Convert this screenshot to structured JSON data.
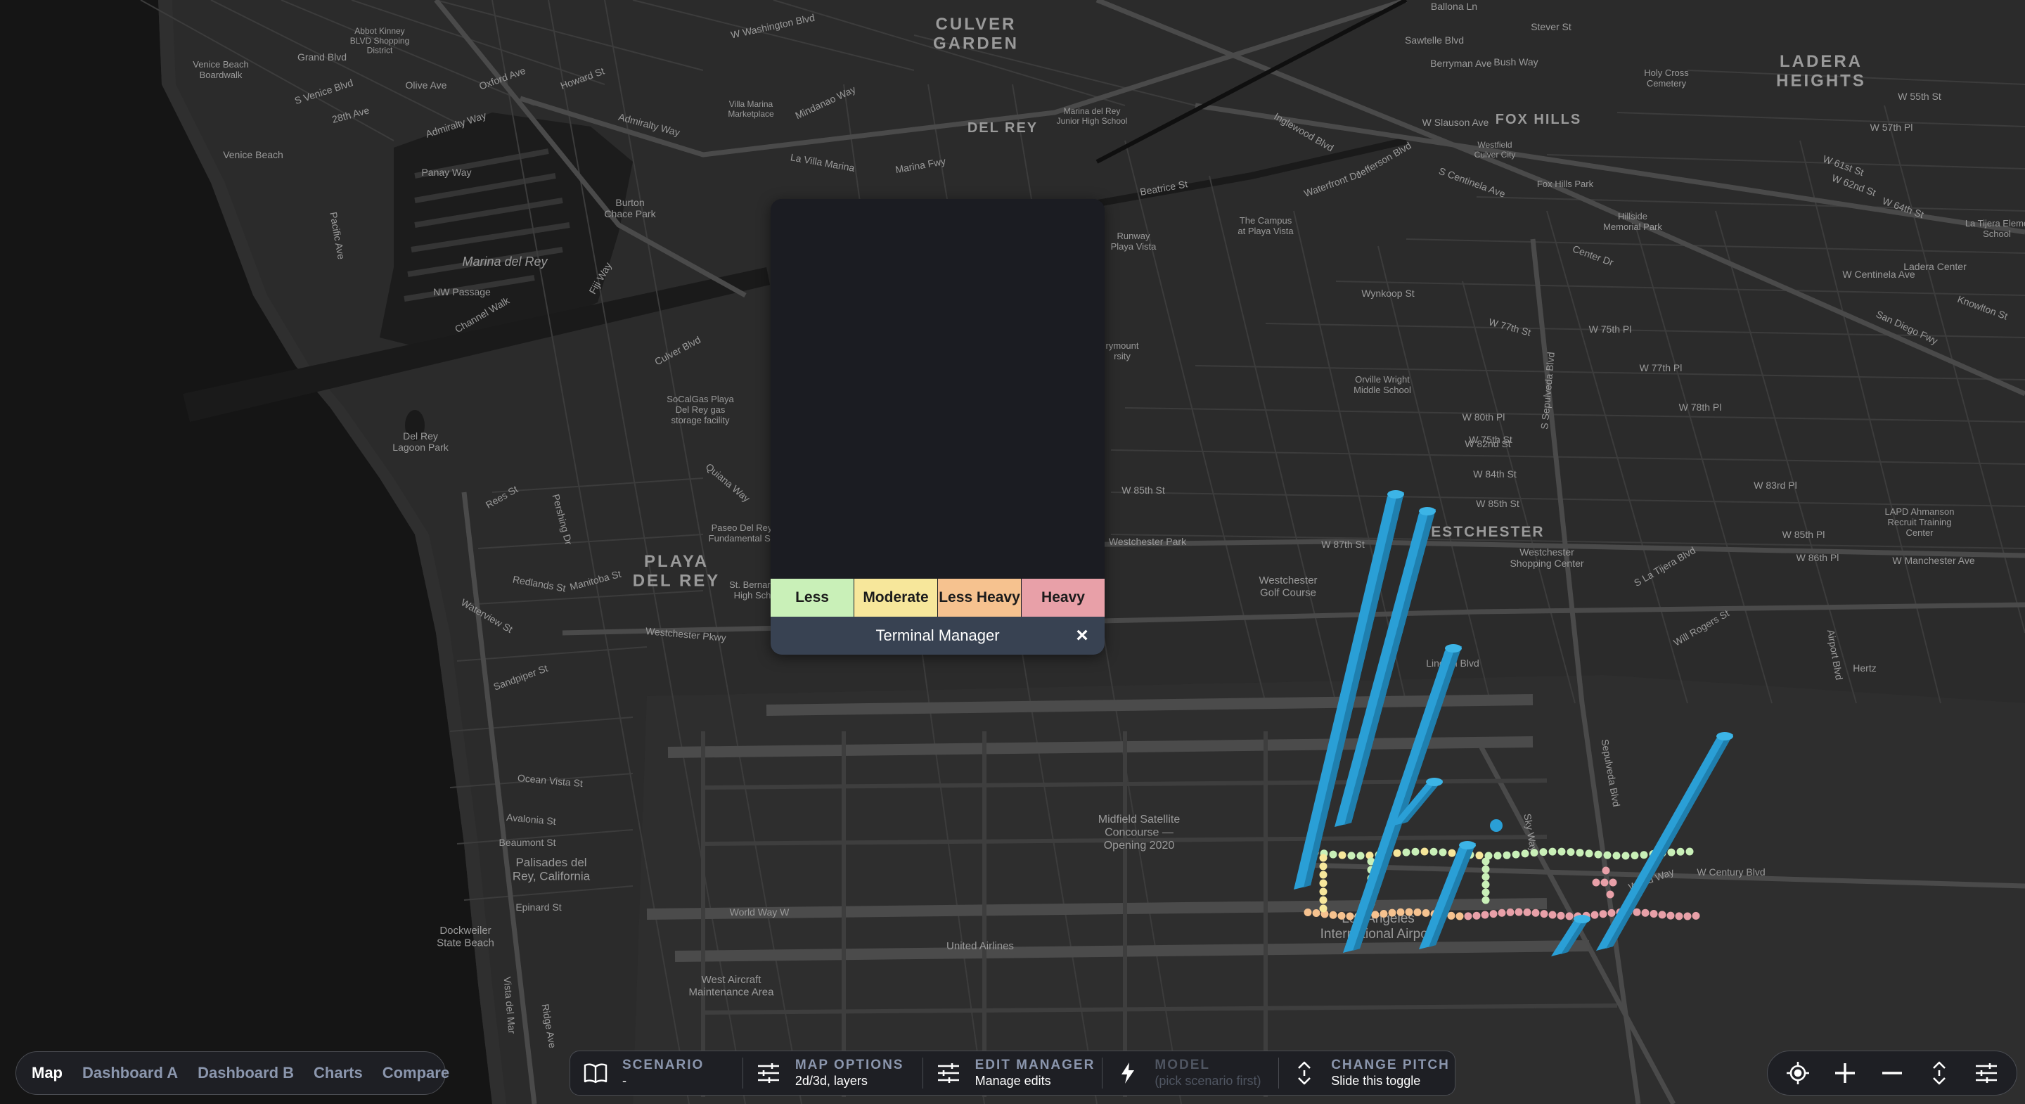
{
  "map": {
    "labels": [
      {
        "id": "culver-garden",
        "text": "CULVER\nGARDEN"
      },
      {
        "id": "ladera-heights",
        "text": "LADERA\nHEIGHTS"
      },
      {
        "id": "fox-hills",
        "text": "FOX HILLS"
      },
      {
        "id": "del-rey",
        "text": "DEL REY"
      },
      {
        "id": "playa-del-rey",
        "text": "PLAYA\nDEL REY"
      },
      {
        "id": "westchester",
        "text": "WESTCHESTER"
      },
      {
        "id": "marina-del-rey",
        "text": "Marina del Rey"
      },
      {
        "id": "venice-beach-boardwalk",
        "text": "Venice Beach\nBoardwalk"
      },
      {
        "id": "venice-beach",
        "text": "Venice Beach"
      },
      {
        "id": "burton-chace-park",
        "text": "Burton\nChace Park"
      },
      {
        "id": "del-rey-lagoon-park",
        "text": "Del Rey\nLagoon Park"
      },
      {
        "id": "socalgas",
        "text": "SoCalGas Playa\nDel Rey gas\nstorage facility"
      },
      {
        "id": "paseo-del-rey",
        "text": "Paseo Del Rey\nFundamental Sc"
      },
      {
        "id": "st-bernard",
        "text": "St. Bernard\nHigh Sch"
      },
      {
        "id": "westchester-park",
        "text": "Westchester Park"
      },
      {
        "id": "westchester-golf",
        "text": "Westchester\nGolf Course"
      },
      {
        "id": "westchester-shopping",
        "text": "Westchester\nShopping Center"
      },
      {
        "id": "lapd",
        "text": "LAPD Ahmanson\nRecruit Training\nCenter"
      },
      {
        "id": "hertz",
        "text": "Hertz"
      },
      {
        "id": "midfield",
        "text": "Midfield Satellite\nConcourse —\nOpening 2020"
      },
      {
        "id": "lax",
        "text": "Los Angeles\nInternational Airport"
      },
      {
        "id": "united-airlines",
        "text": "United Airlines"
      },
      {
        "id": "west-aircraft",
        "text": "West Aircraft\nMaintenance Area"
      },
      {
        "id": "palisades-del-rey",
        "text": "Palisades del\nRey, California"
      },
      {
        "id": "dockweiler",
        "text": "Dockweiler\nState Beach"
      },
      {
        "id": "holy-cross",
        "text": "Holy Cross\nCemetery"
      },
      {
        "id": "hillside",
        "text": "Hillside\nMemorial Park"
      },
      {
        "id": "fox-hills-park",
        "text": "Fox Hills Park"
      },
      {
        "id": "westfield",
        "text": "Westfield\nCulver City"
      },
      {
        "id": "campus",
        "text": "The Campus\nat Playa Vista"
      },
      {
        "id": "runway",
        "text": "Runway\nPlaya Vista"
      },
      {
        "id": "orville",
        "text": "Orville Wright\nMiddle School"
      },
      {
        "id": "villa-marina",
        "text": "Villa Marina\nMarketplace"
      },
      {
        "id": "marina-del-rey-hs",
        "text": "Marina del Rey\nJunior High School"
      },
      {
        "id": "abbot-kinney",
        "text": "Abbot Kinney\nBLVD Shopping\nDistrict"
      },
      {
        "id": "la-tijera",
        "text": "La Tijera Eleme\nSchool"
      },
      {
        "id": "loyola",
        "text": "rymount\nrsity"
      }
    ],
    "streets": [
      {
        "id": "washington-blvd",
        "text": "W Washington Blvd"
      },
      {
        "id": "venice-blvd",
        "text": "S Venice Blvd"
      },
      {
        "id": "admiralty-way",
        "text": "Admiralty Way"
      },
      {
        "id": "admiralty-way-2",
        "text": "Admiralty Way"
      },
      {
        "id": "marina-fwy",
        "text": "Marina Fwy"
      },
      {
        "id": "culver-blvd",
        "text": "Culver Blvd"
      },
      {
        "id": "nw-passage",
        "text": "NW Passage"
      },
      {
        "id": "panay-way",
        "text": "Panay Way"
      },
      {
        "id": "channel-walk",
        "text": "Channel Walk"
      },
      {
        "id": "fiji-way",
        "text": "Fiji Way"
      },
      {
        "id": "jefferson-blvd",
        "text": "Jefferson Blvd"
      },
      {
        "id": "centinela",
        "text": "S Centinela Ave"
      },
      {
        "id": "w-centinela",
        "text": "W Centinela Ave"
      },
      {
        "id": "san-diego-fwy",
        "text": "San Diego Fwy"
      },
      {
        "id": "slauson",
        "text": "W Slauson Ave"
      },
      {
        "id": "manchester",
        "text": "W Manchester Ave"
      },
      {
        "id": "century-blvd",
        "text": "W Century Blvd"
      },
      {
        "id": "westchester-pkwy",
        "text": "Westchester Pkwy"
      },
      {
        "id": "sepulveda",
        "text": "S Sepulveda Blvd"
      },
      {
        "id": "sepulveda-blvd",
        "text": "Sepulveda Blvd"
      },
      {
        "id": "world-way",
        "text": "World Way W"
      },
      {
        "id": "world-way-2",
        "text": "World Way"
      },
      {
        "id": "sky-way",
        "text": "Sky Way"
      },
      {
        "id": "airport-blvd",
        "text": "Airport Blvd"
      },
      {
        "id": "la-tijera-blvd",
        "text": "S La Tijera Blvd"
      },
      {
        "id": "will-rogers",
        "text": "Will Rogers St"
      },
      {
        "id": "lincoln-blvd",
        "text": "Lincoln Blvd"
      },
      {
        "id": "vista-del-mar",
        "text": "Vista del Mar"
      },
      {
        "id": "pacific-ave",
        "text": "Pacific Ave"
      },
      {
        "id": "ocean-vista",
        "text": "Ocean Vista St"
      },
      {
        "id": "beaumont",
        "text": "Beaumont St"
      },
      {
        "id": "epinard",
        "text": "Epinard St"
      },
      {
        "id": "avalonia",
        "text": "Avalonia St"
      },
      {
        "id": "redlands",
        "text": "Redlands St"
      },
      {
        "id": "waterview",
        "text": "Waterview St"
      },
      {
        "id": "manitoba",
        "text": "Manitoba St"
      },
      {
        "id": "rees",
        "text": "Rees St"
      },
      {
        "id": "sandpiper",
        "text": "Sandpiper St"
      },
      {
        "id": "w-85th",
        "text": "W 85th St"
      },
      {
        "id": "w-87th",
        "text": "W 87th St"
      },
      {
        "id": "w-80th",
        "text": "W 80th Pl"
      },
      {
        "id": "w-82nd",
        "text": "W 82nd St"
      },
      {
        "id": "w-84th",
        "text": "W 84th St"
      },
      {
        "id": "w-85th-2",
        "text": "W 85th St"
      },
      {
        "id": "w-77th",
        "text": "W 77th St"
      },
      {
        "id": "w-75th",
        "text": "W 75th Pl"
      },
      {
        "id": "w-83rd",
        "text": "W 83rd Pl"
      },
      {
        "id": "w-85th-pl",
        "text": "W 85th Pl"
      },
      {
        "id": "w-86th",
        "text": "W 86th Pl"
      },
      {
        "id": "w-78th",
        "text": "W 78th Pl"
      },
      {
        "id": "w-77th-pl",
        "text": "W 77th Pl"
      },
      {
        "id": "w-55th",
        "text": "W 55th St"
      },
      {
        "id": "w-57th",
        "text": "W 57th Pl"
      },
      {
        "id": "w-61st",
        "text": "W 61st St"
      },
      {
        "id": "w-62nd",
        "text": "W 62nd St"
      },
      {
        "id": "w-64th",
        "text": "W 64th St"
      },
      {
        "id": "w-75th-st",
        "text": "W 75th St"
      },
      {
        "id": "sawtelle",
        "text": "Sawtelle Blvd"
      },
      {
        "id": "berryman",
        "text": "Berryman Ave"
      },
      {
        "id": "bush-way",
        "text": "Bush Way"
      },
      {
        "id": "stever",
        "text": "Stever St"
      },
      {
        "id": "ballona",
        "text": "Ballona Ln"
      },
      {
        "id": "inglewood-blvd",
        "text": "Inglewood Blvd"
      },
      {
        "id": "waterfront",
        "text": "Waterfront Dr"
      },
      {
        "id": "beatrice",
        "text": "Beatrice St"
      },
      {
        "id": "wynkoop",
        "text": "Wynkoop St"
      },
      {
        "id": "center-dr",
        "text": "Center Dr"
      },
      {
        "id": "ladera-center",
        "text": "Ladera Center"
      },
      {
        "id": "knowlton",
        "text": "Knowlton St"
      },
      {
        "id": "mindanao",
        "text": "Mindanao Way"
      },
      {
        "id": "la-villa-marina",
        "text": "La Villa Marina"
      },
      {
        "id": "oxford",
        "text": "Oxford Ave"
      },
      {
        "id": "olive",
        "text": "Olive Ave"
      },
      {
        "id": "grand",
        "text": "Grand Blvd"
      },
      {
        "id": "28th",
        "text": "28th Ave"
      },
      {
        "id": "howard",
        "text": "Howard St"
      },
      {
        "id": "quiana",
        "text": "Quiana Way"
      },
      {
        "id": "pershing",
        "text": "Pershing Dr"
      },
      {
        "id": "ridge-ave",
        "text": "Ridge Ave"
      }
    ],
    "categories": {
      "less": "#c9f0b8",
      "moderate": "#f7e79b",
      "less_heavy": "#f6c28f",
      "heavy": "#e8a0a8"
    },
    "bar_color": "#2a9fd6"
  },
  "terminal_manager": {
    "legend": [
      {
        "label": "Less",
        "color": "#c9f0b8"
      },
      {
        "label": "Moderate",
        "color": "#f7e79b"
      },
      {
        "label": "Less Heavy",
        "color": "#f6c28f"
      },
      {
        "label": "Heavy",
        "color": "#e8a0a8"
      }
    ],
    "title": "Terminal Manager",
    "close_icon": "×"
  },
  "nav": {
    "tabs": [
      {
        "label": "Map",
        "active": true
      },
      {
        "label": "Dashboard A",
        "active": false
      },
      {
        "label": "Dashboard B",
        "active": false
      },
      {
        "label": "Charts",
        "active": false
      },
      {
        "label": "Compare",
        "active": false
      }
    ]
  },
  "toolbar": {
    "scenario": {
      "title": "SCENARIO",
      "sub": "-",
      "icon": "book-icon"
    },
    "map_options": {
      "title": "MAP OPTIONS",
      "sub": "2d/3d, layers",
      "icon": "sliders-icon"
    },
    "edit_manager": {
      "title": "EDIT MANAGER",
      "sub": "Manage edits",
      "icon": "sliders-icon"
    },
    "model": {
      "title": "MODEL",
      "sub": "(pick scenario first)",
      "icon": "lightning-icon"
    },
    "change_pitch": {
      "title": "CHANGE PITCH",
      "sub": "Slide this toggle",
      "icon": "pitch-icon"
    }
  },
  "controls": [
    "locate-icon",
    "zoom-in-icon",
    "zoom-out-icon",
    "pitch-toggle-icon",
    "settings-sliders-icon"
  ]
}
